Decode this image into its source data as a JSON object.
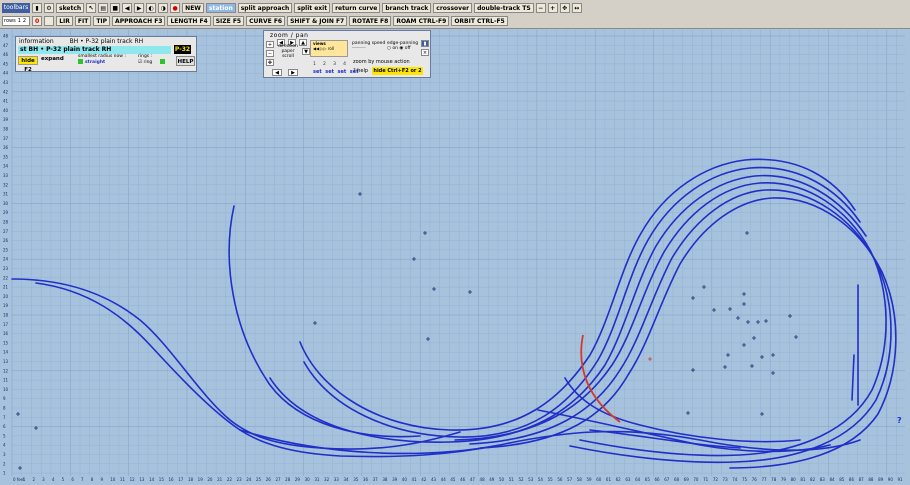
{
  "toolbar": {
    "label": "toolbars",
    "rows_label": "rows",
    "rows_1": "1",
    "rows_2": "2",
    "row1": [
      "sketch",
      "NEW",
      "station",
      "split  approach",
      "split  exit",
      "return curve",
      "branch track",
      "crossover",
      "double-track TS"
    ],
    "row2": [
      "0",
      "LIR",
      "FIT",
      "TIP",
      "APPROACH  F3",
      "LENGTH  F4",
      "SIZE  F5",
      "CURVE  F6",
      "SHIFT & JOIN  F7",
      "ROTATE  F8",
      "ROAM  CTRL-F9",
      "ORBIT  CTRL-F5"
    ]
  },
  "info_panel": {
    "label": "information",
    "item_name": "BH • P-32  plain track   RH",
    "current_line": "st   BH • P-32  plain track   RH",
    "code": "P-32",
    "hide_label": "hide  F2",
    "expand_label": "expand",
    "radius_label": "smallest  radius  now :",
    "radius_value": "straight",
    "rings_label": "rings :",
    "rings_value": "ring",
    "help_label": "HELP"
  },
  "zoom_panel": {
    "title": "zoom  /  pan",
    "direction_label": "direction",
    "paper_label": "paper",
    "scroll_label": "scroll",
    "views_label": "views",
    "roll_label": "roll",
    "panning_speed_label": "panning  speed",
    "edge_panning_label": "edge-panning",
    "on_label": "on",
    "off_label": "off",
    "zoom_by_label": "zoom  by  mouse  action",
    "help_label": "? help",
    "hide_label": "hide   Ctrl+F2  or  2",
    "view_numbers": [
      "1",
      "2",
      "3",
      "4"
    ],
    "set_labels": [
      "set",
      "set",
      "set",
      "set"
    ]
  },
  "grid": {
    "x_labels": [
      "0  feet",
      "1",
      "2",
      "3",
      "4",
      "5",
      "6",
      "7",
      "8",
      "9",
      "10",
      "11",
      "12",
      "13",
      "14",
      "15",
      "16",
      "17",
      "18",
      "19",
      "20",
      "21",
      "22",
      "23",
      "24",
      "25",
      "26",
      "27",
      "28",
      "29",
      "30",
      "31",
      "32",
      "33",
      "34",
      "35",
      "36",
      "37",
      "38",
      "39",
      "40",
      "41",
      "42",
      "43",
      "44",
      "45",
      "46",
      "47",
      "48",
      "49",
      "50",
      "51",
      "52",
      "53",
      "54",
      "55",
      "56",
      "57",
      "58",
      "59",
      "60",
      "61",
      "62",
      "63",
      "64",
      "65",
      "66",
      "67",
      "68",
      "69",
      "70",
      "71",
      "72",
      "73",
      "74",
      "75",
      "76",
      "77",
      "78",
      "79",
      "80",
      "81",
      "82",
      "83",
      "84",
      "85",
      "86",
      "87",
      "88",
      "89",
      "90",
      "91"
    ],
    "y_labels": [
      "48",
      "47",
      "46",
      "45",
      "44",
      "43",
      "42",
      "41",
      "40",
      "39",
      "38",
      "37",
      "36",
      "35",
      "34",
      "33",
      "32",
      "31",
      "30",
      "29",
      "28",
      "27",
      "26",
      "25",
      "24",
      "23",
      "22",
      "21",
      "20",
      "19",
      "18",
      "17",
      "16",
      "15",
      "14",
      "13",
      "12",
      "11",
      "10",
      "9",
      "8",
      "7",
      "6",
      "5",
      "4",
      "3",
      "2",
      "1"
    ]
  },
  "help_corner": "?",
  "colors": {
    "background": "#a6c2dd",
    "track": "#1f2fc8",
    "highlight_track": "#d23a2a",
    "grid": "#94b3d3",
    "grid_major": "#7fa0c6"
  }
}
